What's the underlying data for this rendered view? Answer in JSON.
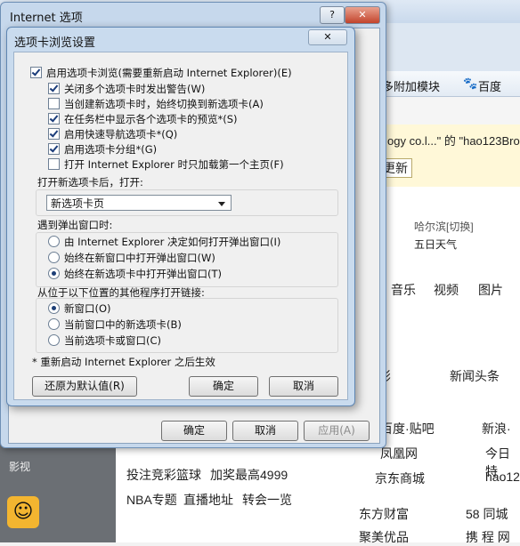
{
  "background": {
    "toolbar": {
      "addons": "多附加模块",
      "baidu": "百度"
    },
    "notice": {
      "line1": "ogy co.l...\" 的 \"hao123Bro",
      "update": "更新"
    },
    "weather": {
      "city": "哈尔滨[切换]",
      "forecast": "五日天气"
    },
    "tabs": [
      "音乐",
      "视频",
      "图片"
    ],
    "news": [
      "影",
      "新闻头条"
    ],
    "links": [
      "百度·贴吧",
      "新浪·",
      "凤凰网",
      "今日特",
      "京东商城",
      "hao12",
      "东方财富",
      "58 同城",
      "聚美优品",
      "携 程 网"
    ],
    "left_items": [
      "影视"
    ],
    "promo": [
      "投注竞彩篮球",
      "加奖最高4999",
      "NBA专题",
      "直播地址",
      "转会一览"
    ]
  },
  "outer_dialog": {
    "title": "Internet 选项",
    "help_btn": "?",
    "close_btn": "✕",
    "ok": "确定",
    "cancel": "取消",
    "apply": "应用(A)"
  },
  "inner_dialog": {
    "title": "选项卡浏览设置",
    "close_btn": "✕",
    "main_check": {
      "label": "启用选项卡浏览(需要重新启动 Internet Explorer)(E)",
      "checked": true
    },
    "checks": [
      {
        "label": "关闭多个选项卡时发出警告(W)",
        "checked": true
      },
      {
        "label": "当创建新选项卡时，始终切换到新选项卡(A)",
        "checked": false
      },
      {
        "label": "在任务栏中显示各个选项卡的预览*(S)",
        "checked": true
      },
      {
        "label": "启用快速导航选项卡*(Q)",
        "checked": true
      },
      {
        "label": "启用选项卡分组*(G)",
        "checked": true
      },
      {
        "label": "打开 Internet Explorer 时只加载第一个主页(F)",
        "checked": false
      }
    ],
    "newtab_group_label": "打开新选项卡后，打开:",
    "newtab_select": "新选项卡页",
    "popup_group_label": "遇到弹出窗口时:",
    "popup_options": [
      {
        "label": "由 Internet Explorer 决定如何打开弹出窗口(I)",
        "checked": false
      },
      {
        "label": "始终在新窗口中打开弹出窗口(W)",
        "checked": false
      },
      {
        "label": "始终在新选项卡中打开弹出窗口(T)",
        "checked": true
      }
    ],
    "links_group_label": "从位于以下位置的其他程序打开链接:",
    "links_options": [
      {
        "label": "新窗口(O)",
        "checked": true
      },
      {
        "label": "当前窗口中的新选项卡(B)",
        "checked": false
      },
      {
        "label": "当前选项卡或窗口(C)",
        "checked": false
      }
    ],
    "note": "* 重新启动 Internet Explorer 之后生效",
    "restore": "还原为默认值(R)",
    "ok": "确定",
    "cancel": "取消"
  }
}
